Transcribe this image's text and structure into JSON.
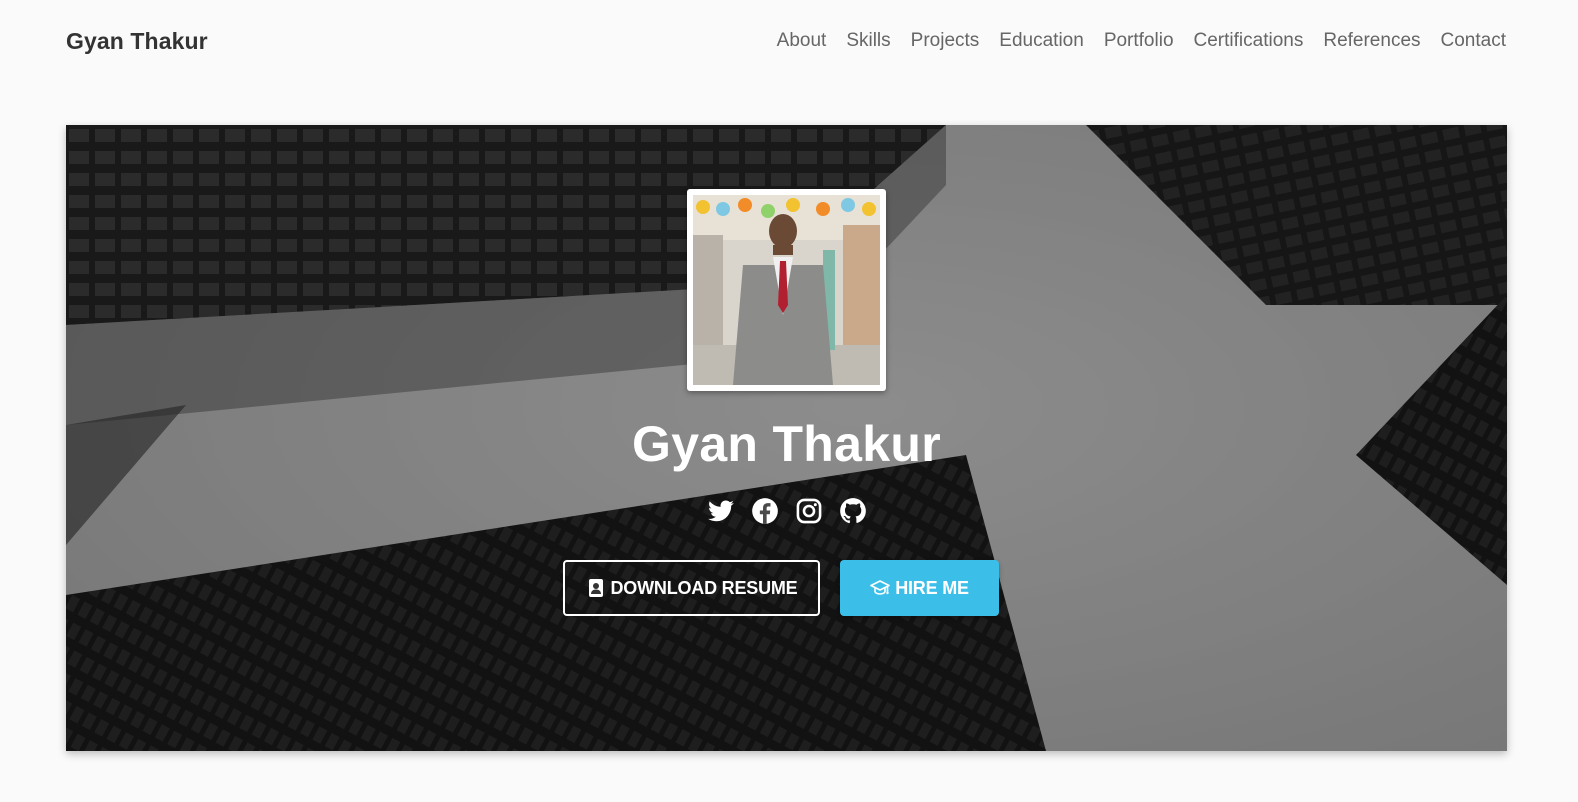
{
  "navbar": {
    "brand": "Gyan Thakur",
    "links": [
      {
        "label": "About"
      },
      {
        "label": "Skills"
      },
      {
        "label": "Projects"
      },
      {
        "label": "Education"
      },
      {
        "label": "Portfolio"
      },
      {
        "label": "Certifications"
      },
      {
        "label": "References"
      },
      {
        "label": "Contact"
      }
    ]
  },
  "hero": {
    "name": "Gyan Thakur",
    "socials": [
      {
        "icon": "twitter-icon"
      },
      {
        "icon": "facebook-icon"
      },
      {
        "icon": "instagram-icon"
      },
      {
        "icon": "github-icon"
      }
    ],
    "buttons": {
      "resume_label": "DOWNLOAD RESUME",
      "resume_icon": "resume-badge-icon",
      "hire_label": "HIRE ME",
      "hire_icon": "graduation-cap-icon"
    }
  },
  "colors": {
    "background": "#fafafa",
    "brand_text": "#333333",
    "nav_text": "#666666",
    "hire_button": "#3bbfe9",
    "hero_text": "#ffffff"
  }
}
